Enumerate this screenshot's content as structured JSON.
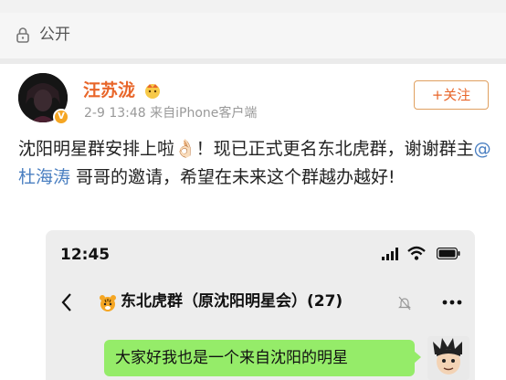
{
  "privacy": {
    "label": "公开",
    "icon": "lock-icon"
  },
  "post": {
    "author": "汪苏泷",
    "meta": "2-9 13:48  来自iPhone客户端",
    "follow_label": "+关注",
    "text_part1": "沈阳明星群安排上啦👌🏻！现已正式更名东北虎群，谢谢群主",
    "mention": "@杜海涛",
    "text_part2": " 哥哥的邀请，希望在未来这个群越办越好!"
  },
  "screenshot": {
    "time": "12:45",
    "group_title": "东北虎群（原沈阳明星会）(27)",
    "message": "大家好我也是一个来自沈阳的明星"
  },
  "colors": {
    "accent": "#e8662a",
    "mention": "#4a7fc1",
    "bubble": "#95ec69"
  }
}
